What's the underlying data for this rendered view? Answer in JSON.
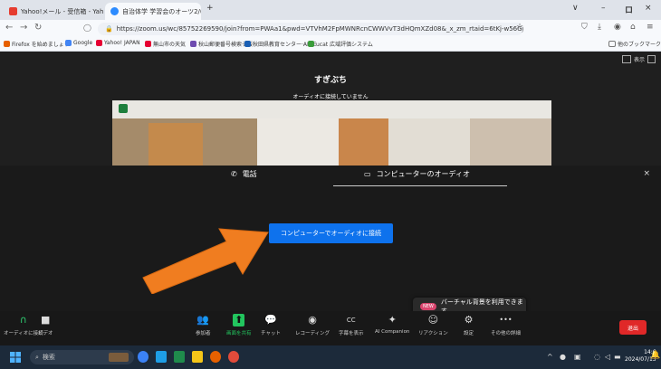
{
  "browser": {
    "tabs": [
      {
        "label": "Yahoo!メール - 受信箱 - Yahoo!メ",
        "icon": "yahoo-icon",
        "color": "#e63c2f"
      },
      {
        "label": "自治体学 学習会のオーツ2/(会社 ×",
        "icon": "zoom-icon",
        "color": "#2d8cff"
      }
    ],
    "new_tab": "+",
    "window_controls": {
      "dropdown": "∨",
      "minimize": "–",
      "maximize": "ロ",
      "close": "×"
    },
    "url_prefix": "https://",
    "url": "https://zoom.us/wc/85752269590/join?from=PWAa1&pwd=VTVhM2FpMWNRcnCWWVvT3dHQmXZd08&_x_zm_rtaid=6tKj-w56GjXIb5f1gbdA.1",
    "bookmarks": [
      {
        "label": "Firefox を始めましょう",
        "color": "#e66000"
      },
      {
        "label": "Google",
        "color": "#4285f4"
      },
      {
        "label": "Yahoo! JAPAN",
        "color": "#e60033"
      },
      {
        "label": "無山市の天気",
        "color": "#e60033"
      },
      {
        "label": "秋山郵便番号検索テ版",
        "color": "#6f4cb0"
      },
      {
        "label": "秋田県教育センター·ALVE",
        "color": "#1a5fb4"
      },
      {
        "label": "ucat 広域評価システム",
        "color": "#3b9c3b"
      }
    ],
    "other_bookmarks": "他のブックマーク"
  },
  "meeting": {
    "gallery_label": "表示",
    "title": "すぎぶち",
    "subtitle": "オーディオに接続していません",
    "audio_tabs": [
      {
        "label": "電話",
        "icon": "phone-icon",
        "glyph": "✆"
      },
      {
        "label": "コンピューターのオーディオ",
        "icon": "computer-audio-icon",
        "glyph": "▭"
      }
    ],
    "close": "×",
    "join_button": "コンピューターでオーディオに接続",
    "toast_badge": "NEW",
    "toast_text": "バーチャル背景を利用できます"
  },
  "toolbar": {
    "left": [
      {
        "label": "オーディオに接続",
        "icon": "headphones-icon",
        "glyph": "∩"
      },
      {
        "label": "ビデオ",
        "icon": "video-icon",
        "glyph": "■"
      }
    ],
    "center": [
      {
        "label": "参加者",
        "icon": "participants-icon",
        "glyph": "👥"
      },
      {
        "label": "画面を共有",
        "icon": "share-screen-icon",
        "glyph": "⬆"
      },
      {
        "label": "チャット",
        "icon": "chat-icon",
        "glyph": "💬"
      },
      {
        "label": "レコーディング",
        "icon": "record-icon",
        "glyph": "◉"
      },
      {
        "label": "字幕を表示",
        "icon": "captions-icon",
        "glyph": "CC"
      },
      {
        "label": "AI Companion",
        "icon": "ai-companion-icon",
        "glyph": "✦"
      },
      {
        "label": "リアクション",
        "icon": "reaction-icon",
        "glyph": "☺"
      },
      {
        "label": "設定",
        "icon": "settings-icon",
        "glyph": "⚙"
      },
      {
        "label": "その他の詳細",
        "icon": "more-icon",
        "glyph": "•••"
      }
    ],
    "end_button": "退出",
    "accent": "#0e72ed",
    "end_color": "#e02828"
  },
  "taskbar": {
    "search_placeholder": "検索",
    "time": "14:6",
    "date": "2024/07/13"
  }
}
